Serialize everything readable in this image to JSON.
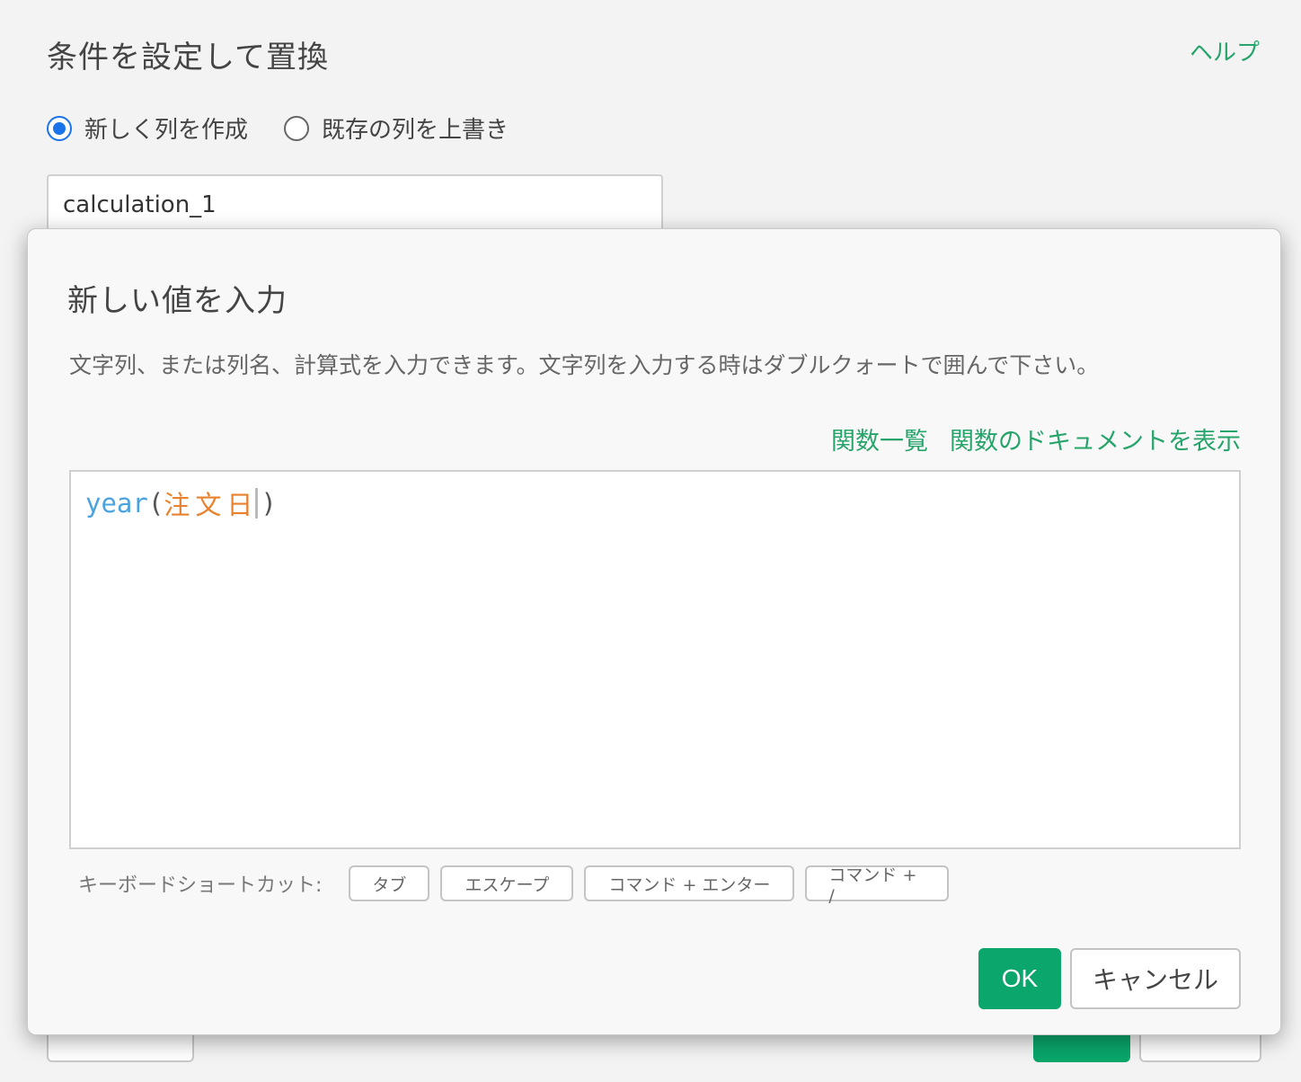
{
  "background": {
    "title": "条件を設定して置換",
    "help_link": "ヘルプ",
    "radio_options": [
      {
        "label": "新しく列を作成",
        "checked": true
      },
      {
        "label": "既存の列を上書き",
        "checked": false
      }
    ],
    "column_name_value": "calculation_1"
  },
  "modal": {
    "title": "新しい値を入力",
    "description": "文字列、または列名、計算式を入力できます。文字列を入力する時はダブルクォートで囲んで下さい。",
    "links": {
      "function_list": "関数一覧",
      "function_docs": "関数のドキュメントを表示"
    },
    "editor": {
      "function": "year",
      "open_paren": "(",
      "column": "注文日",
      "close_paren": ")"
    },
    "shortcuts": {
      "label": "キーボードショートカット:",
      "keys": [
        "タブ",
        "エスケープ",
        "コマンド + エンター",
        "コマンド + /"
      ]
    },
    "ok_label": "OK",
    "cancel_label": "キャンセル"
  },
  "colors": {
    "accent_green": "#0aa66b",
    "link_green": "#27a46b",
    "radio_blue": "#1a73e8",
    "function_token": "#4aa3df",
    "column_token": "#e8822e"
  }
}
